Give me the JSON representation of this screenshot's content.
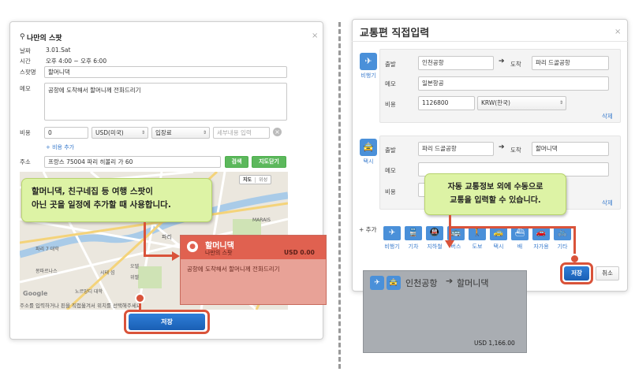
{
  "left": {
    "title": "나만의 스팟",
    "fields": {
      "date_label": "날짜",
      "date_value": "3.01.Sat",
      "time_label": "시간",
      "time_value": "오후 4:00 ~ 오후 6:00",
      "spot_label": "스팟명",
      "spot_value": "할머니댁",
      "memo_label": "메모",
      "memo_value": "공항에 도착해서 할머니께 전화드리기",
      "cost_label": "비용",
      "cost_value": "0",
      "currency": "USD(미국)",
      "category": "입장료",
      "detail_placeholder": "세부내용 입력",
      "add_cost": "+ 비용 추가",
      "address_label": "주소",
      "address_value": "프랑스 75004 파리 히볼리 가 60",
      "search_btn": "검색",
      "clear_map_btn": "지도닫기"
    },
    "map": {
      "map_toggle": "지도",
      "satellite_toggle": "위성",
      "place_labels": [
        "MARAIS",
        "파리",
        "시테 섬",
        "오델",
        "파리 7 대학",
        "노르망디 대학",
        "몽파르나스",
        "위젤"
      ],
      "google": "Google",
      "footer_hint": "주소를 입력하거나 핀을 직접옮겨서 위치를 선택해주세요"
    },
    "callout": {
      "line1": "할머니댁, 친구네집 등 여행 스팟이",
      "line2": "아닌 곳을 일정에 추가할 때 사용합니다."
    },
    "preview": {
      "title": "할머니댁",
      "subtitle": "나만의 스팟",
      "cost": "USD 0.00",
      "memo": "공항에 도착해서 할머니께 전화드리기"
    },
    "save_btn": "저장"
  },
  "right": {
    "title": "교통편 직접입력",
    "seg1": {
      "mode": "비행기",
      "depart_label": "출발",
      "depart_value": "인천공항",
      "arrive_label": "도착",
      "arrive_value": "파리 드골공항",
      "memo_label": "메모",
      "memo_value": "일본항공",
      "cost_label": "비용",
      "cost_value": "1126800",
      "currency": "KRW(한국)",
      "delete": "삭제"
    },
    "seg2": {
      "mode": "택시",
      "depart_label": "출발",
      "depart_value": "파리 드골공항",
      "arrive_label": "도착",
      "arrive_value": "할머니댁",
      "memo_label": "메모",
      "cost_label": "비용",
      "delete": "삭제"
    },
    "callout": {
      "line1": "자동 교통정보 외에 수동으로",
      "line2": "교통을 입력할 수 있습니다."
    },
    "add_label": "+ 추가",
    "transports": [
      "비행기",
      "기차",
      "지하철",
      "버스",
      "도보",
      "택시",
      "배",
      "자가용",
      "기타"
    ],
    "summary": {
      "route_from": "인천공항",
      "route_to": "할머니댁",
      "cost": "USD 1,166.00"
    },
    "save_btn": "저장",
    "cancel_btn": "취소"
  },
  "colors": {
    "accent_blue": "#1a5fb4",
    "callout_green": "#ddf3a5",
    "highlight_red": "#d9533a",
    "preview_red": "#e07f72",
    "summary_gray": "#a9adb2"
  }
}
